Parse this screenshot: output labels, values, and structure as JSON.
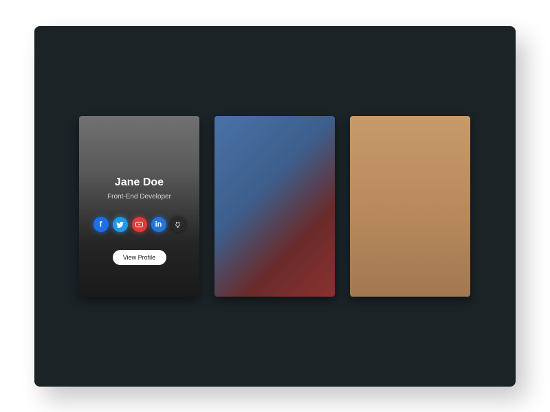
{
  "profile_card": {
    "name": "Jane Doe",
    "role": "Front-End Developer",
    "view_profile_label": "View Profile",
    "social_icons": [
      "facebook-icon",
      "twitter-icon",
      "youtube-icon",
      "linkedin-icon",
      "github-icon"
    ]
  },
  "colors": {
    "frame_bg": "#1b2327",
    "facebook": "#1c6fe6",
    "twitter": "#1e9ae8",
    "youtube": "#e23a3a",
    "linkedin": "#2274d6",
    "github": "#2a2a2a"
  }
}
